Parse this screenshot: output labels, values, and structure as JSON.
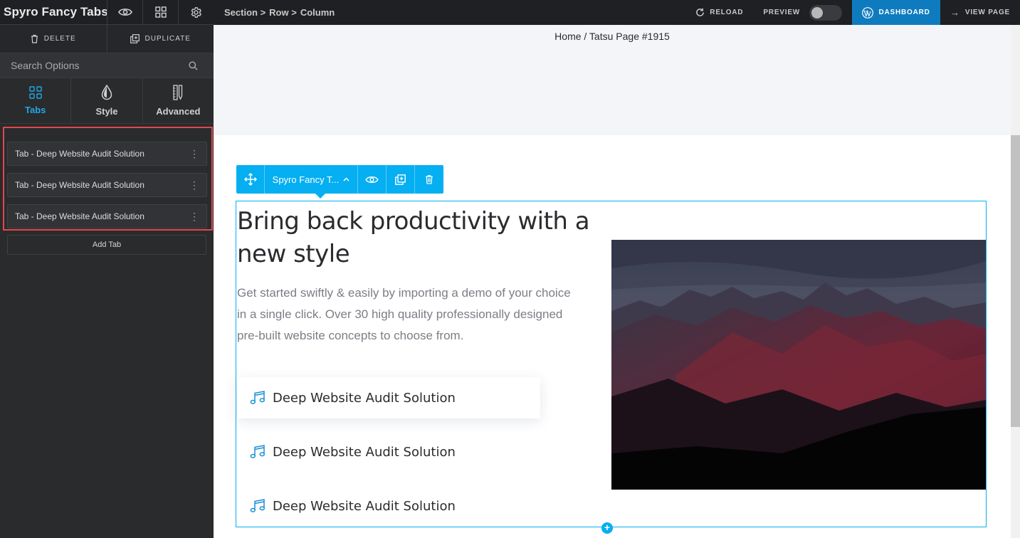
{
  "sidebar": {
    "title": "Spyro Fancy Tabs",
    "delete_label": "DELETE",
    "duplicate_label": "DUPLICATE",
    "search_placeholder": "Search Options",
    "tabs": [
      {
        "label": "Tabs",
        "icon": "grid-icon",
        "active": true
      },
      {
        "label": "Style",
        "icon": "drop-icon",
        "active": false
      },
      {
        "label": "Advanced",
        "icon": "pencil-ruler-icon",
        "active": false
      }
    ],
    "repeater_items": [
      "Tab - Deep Website Audit Solution",
      "Tab - Deep Website Audit Solution",
      "Tab - Deep Website Audit Solution"
    ],
    "add_tab_label": "Add Tab"
  },
  "topbar": {
    "breadcrumb": [
      "Section >",
      "Row >",
      "Column"
    ],
    "reload_label": "RELOAD",
    "preview_label": "PREVIEW",
    "dashboard_label": "DASHBOARD",
    "view_page_label": "VIEW PAGE"
  },
  "canvas": {
    "page_breadcrumb": "Home / Tatsu Page #1915",
    "element_toolbar_name": "Spyro Fancy T...",
    "heading": "Bring back productivity with a new style",
    "description": "Get started swiftly & easily by importing a demo of your choice in a single click. Over 30 high quality professionally designed pre-built website concepts to choose from.",
    "fancy_tabs": [
      {
        "label": "Deep Website Audit Solution",
        "icon": "music-note-icon",
        "active": true
      },
      {
        "label": "Deep Website Audit Solution",
        "icon": "music-note-icon",
        "active": false
      },
      {
        "label": "Deep Website Audit Solution",
        "icon": "music-note-icon",
        "active": false
      }
    ]
  },
  "colors": {
    "accent": "#05aff1",
    "dashboard": "#0f7bbf",
    "highlight_border": "#e0484a",
    "active_tab": "#21a7e4"
  }
}
